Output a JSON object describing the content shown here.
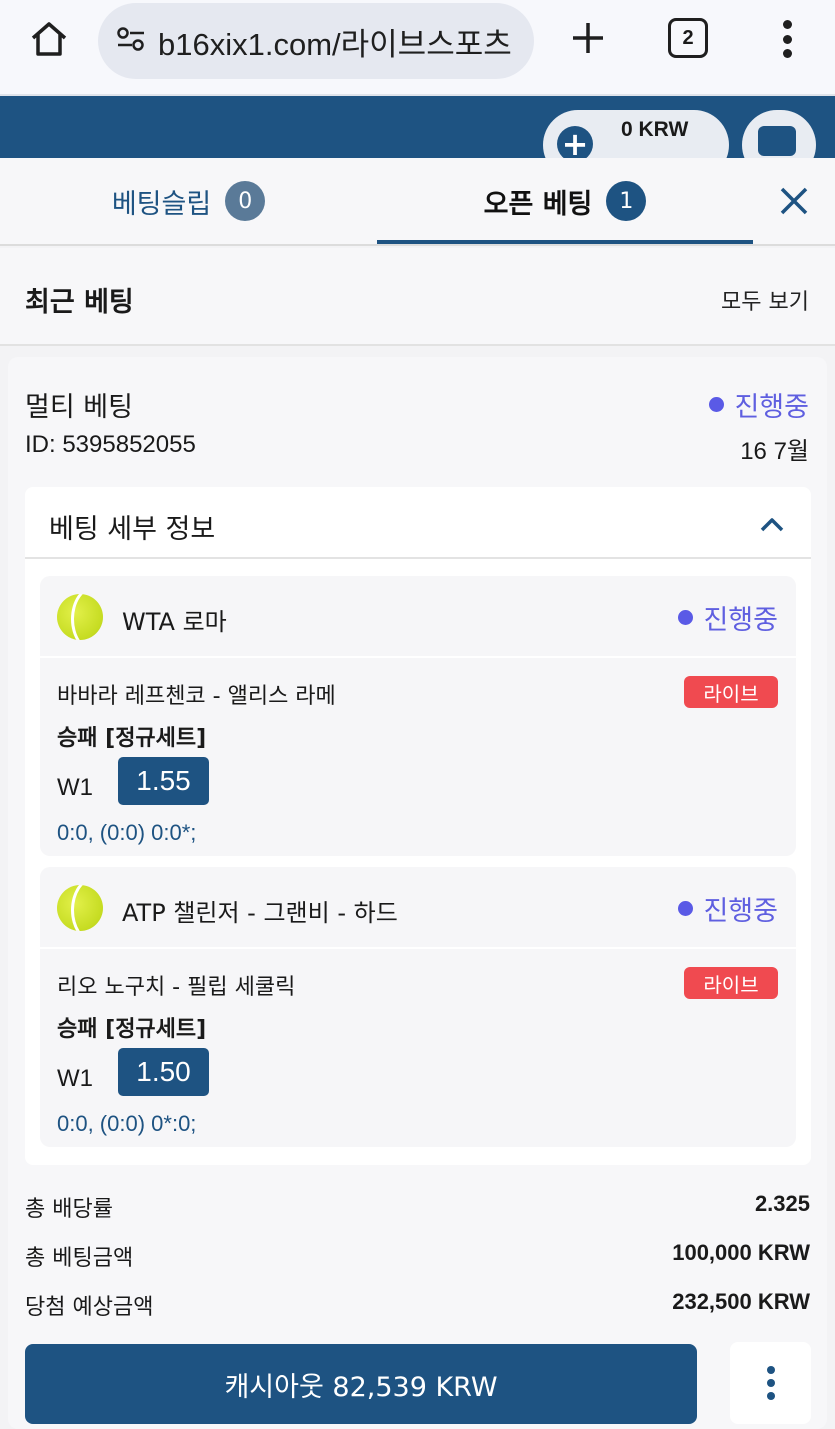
{
  "browser": {
    "url": "b16xix1.com/라이브스포츠",
    "tab_count": "2"
  },
  "header": {
    "balance": "0 KRW"
  },
  "tabs": {
    "slip_label": "베팅슬립",
    "slip_count": "0",
    "open_label": "오픈 베팅",
    "open_count": "1"
  },
  "recent": {
    "title": "최근 베팅",
    "view_all": "모두 보기"
  },
  "bet": {
    "type": "멀티 베팅",
    "status": "진행중",
    "id": "ID: 5395852055",
    "date": "16 7월",
    "details_title": "베팅 세부 정보",
    "selections": [
      {
        "league": "WTA 로마",
        "status": "진행중",
        "match": "바바라 레프첸코 - 앨리스 라메",
        "live": "라이브",
        "market": "승패 [정규세트]",
        "outcome": "W1",
        "odds": "1.55",
        "score": "0:0, (0:0) 0:0*;"
      },
      {
        "league": "ATP 챌린저 - 그랜비 - 하드",
        "status": "진행중",
        "match": "리오 노구치 - 필립 세쿨릭",
        "live": "라이브",
        "market": "승패 [정규세트]",
        "outcome": "W1",
        "odds": "1.50",
        "score": "0:0, (0:0) 0*:0;"
      }
    ],
    "summary": {
      "total_odds_label": "총 배당률",
      "total_odds": "2.325",
      "stake_label": "총 베팅금액",
      "stake": "100,000 KRW",
      "potential_label": "당첨 예상금액",
      "potential": "232,500 KRW"
    },
    "cashout_label": "캐시아웃 82,539 KRW"
  },
  "colors": {
    "primary": "#1e5382",
    "status": "#5f5fe0",
    "live": "#f04a50"
  }
}
